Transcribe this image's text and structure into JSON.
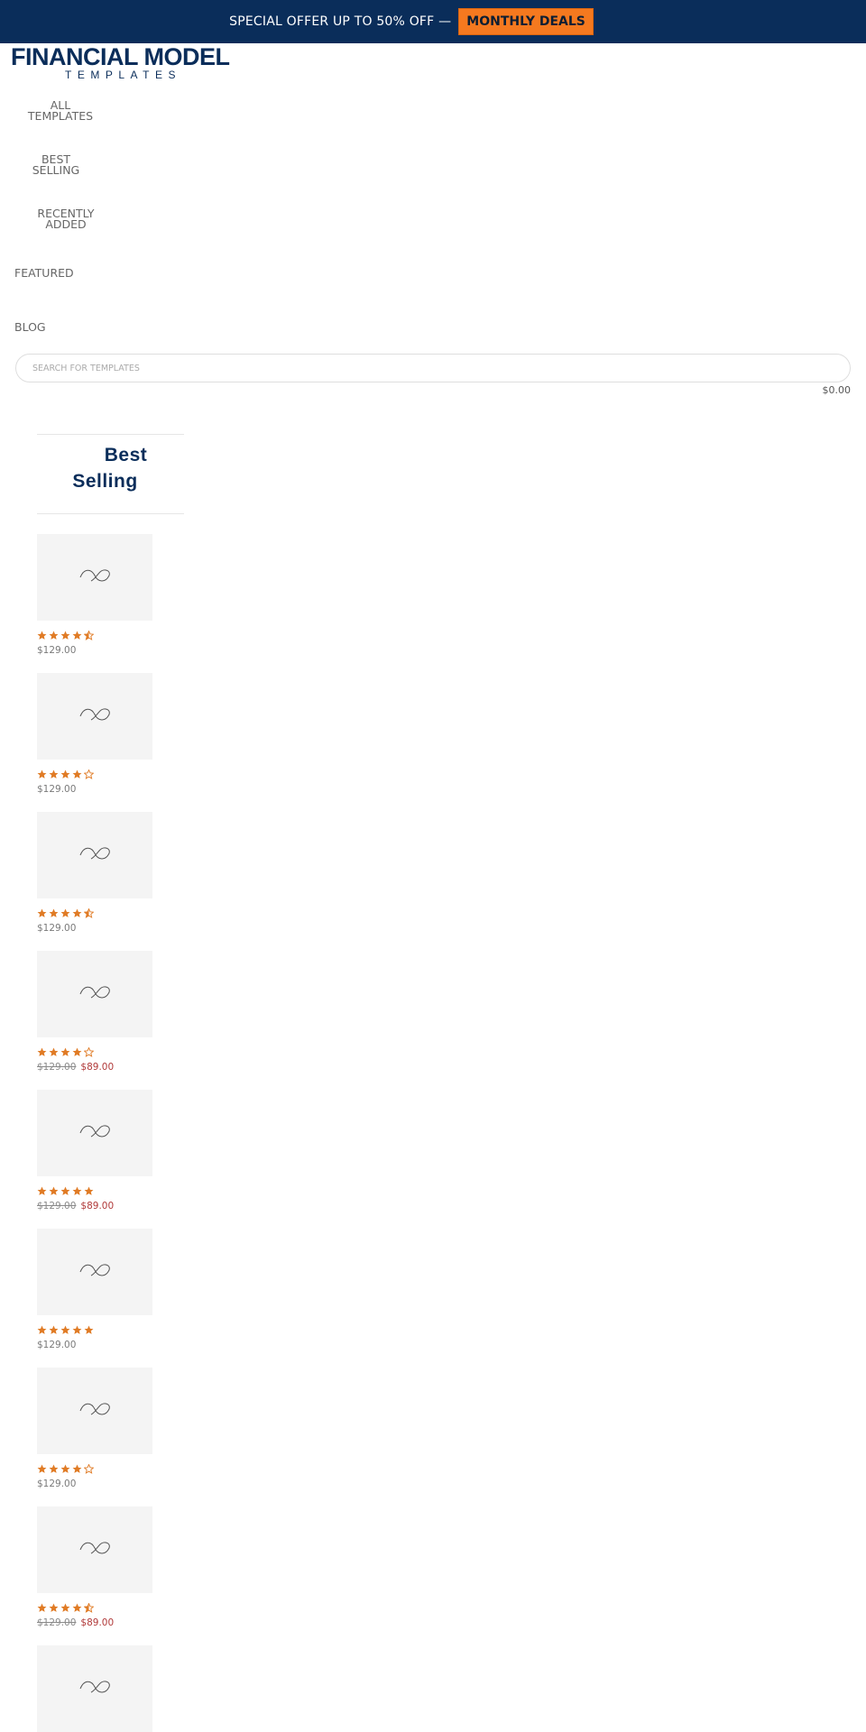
{
  "promo": {
    "text": "SPECIAL OFFER UP TO 50% OFF —",
    "button_label": "MONTHLY DEALS"
  },
  "logo": {
    "main": "FINANCIAL MODEL",
    "sub": "TEMPLATES"
  },
  "nav": {
    "all_templates": [
      "ALL",
      "TEMPLATES"
    ],
    "best_selling": [
      "BEST",
      "SELLING"
    ],
    "recently_added": [
      "RECENTLY",
      "ADDED"
    ],
    "featured": "FEATURED",
    "blog": "BLOG"
  },
  "search": {
    "placeholder": "SEARCH FOR TEMPLATES"
  },
  "cart": {
    "total": "$0.00"
  },
  "widget": {
    "title_line1": "Best",
    "title_line2": "Selling"
  },
  "colors": {
    "brand": "#0a2d5a",
    "accent": "#f5791f",
    "star": "#e07b25",
    "sale": "#b13a3a"
  },
  "products": [
    {
      "rating": 4.5,
      "price": "$129.00",
      "old_price": "",
      "sale_price": ""
    },
    {
      "rating": 4,
      "price": "$129.00",
      "old_price": "",
      "sale_price": ""
    },
    {
      "rating": 4.5,
      "price": "$129.00",
      "old_price": "",
      "sale_price": ""
    },
    {
      "rating": 4,
      "price": "",
      "old_price": "$129.00",
      "sale_price": "$89.00"
    },
    {
      "rating": 5,
      "price": "",
      "old_price": "$129.00",
      "sale_price": "$89.00"
    },
    {
      "rating": 5,
      "price": "$129.00",
      "old_price": "",
      "sale_price": ""
    },
    {
      "rating": 4,
      "price": "$129.00",
      "old_price": "",
      "sale_price": ""
    },
    {
      "rating": 4.5,
      "price": "",
      "old_price": "$129.00",
      "sale_price": "$89.00"
    },
    {
      "rating": null,
      "price": "",
      "old_price": "",
      "sale_price": ""
    }
  ]
}
